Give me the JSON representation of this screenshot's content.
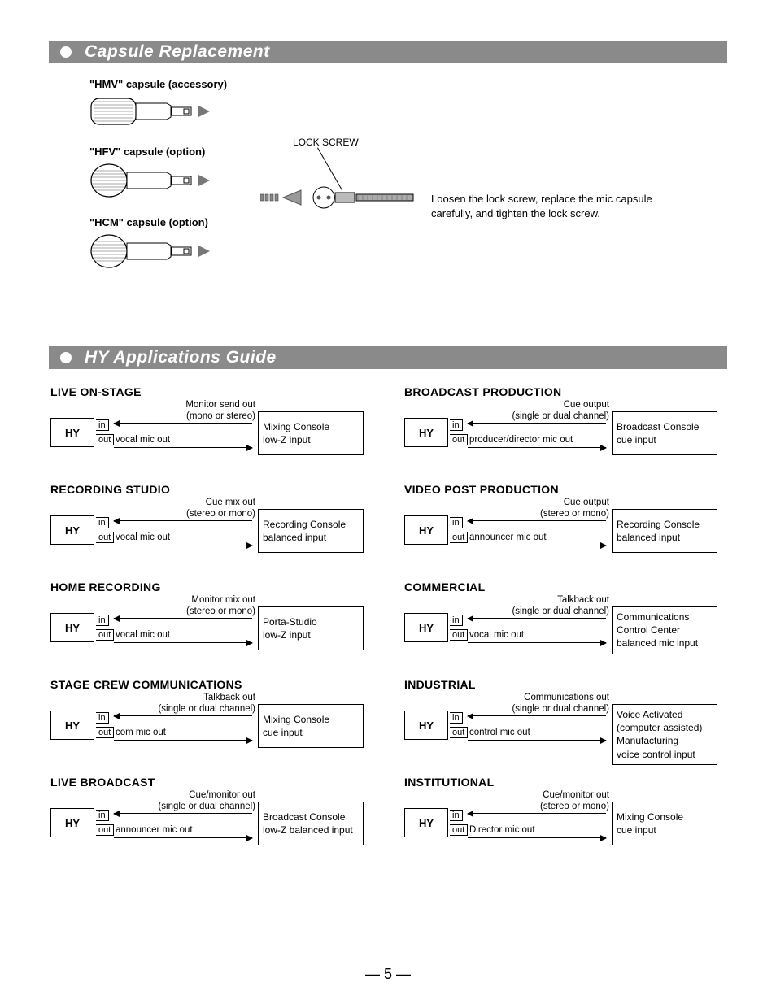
{
  "sections": {
    "capsule_title": "Capsule Replacement",
    "apps_title": "HY Applications Guide"
  },
  "capsule": {
    "hmv": "\"HMV\" capsule (accessory)",
    "hfv": "\"HFV\" capsule (option)",
    "hcm": "\"HCM\" capsule (option)",
    "lock": "LOCK SCREW",
    "instruction": "Loosen the lock screw, replace the mic capsule carefully, and tighten the lock screw."
  },
  "port": {
    "in": "in",
    "out": "out",
    "hy": "HY"
  },
  "apps_left": [
    {
      "title": "LIVE ON-STAGE",
      "line1": "Monitor send out",
      "line2": "(mono or stereo)",
      "out_text": "vocal mic out",
      "console1": "Mixing Console",
      "console2": "low-Z input"
    },
    {
      "title": "RECORDING STUDIO",
      "line1": "Cue mix out",
      "line2": "(stereo or mono)",
      "out_text": "vocal mic out",
      "console1": "Recording Console",
      "console2": "balanced input"
    },
    {
      "title": "HOME RECORDING",
      "line1": "Monitor mix out",
      "line2": "(stereo or mono)",
      "out_text": "vocal mic out",
      "console1": "Porta-Studio",
      "console2": "low-Z input"
    },
    {
      "title": "STAGE CREW COMMUNICATIONS",
      "line1": "Talkback out",
      "line2": "(single or dual channel)",
      "out_text": "com mic out",
      "console1": "Mixing Console",
      "console2": "cue input"
    },
    {
      "title": "LIVE BROADCAST",
      "line1": "Cue/monitor out",
      "line2": "(single or dual channel)",
      "out_text": "announcer mic out",
      "console1": "Broadcast Console",
      "console2": "low-Z balanced input"
    }
  ],
  "apps_right": [
    {
      "title": "BROADCAST PRODUCTION",
      "line1": "Cue output",
      "line2": "(single or dual channel)",
      "out_text": "producer/director mic out",
      "console1": "Broadcast Console",
      "console2": "cue input"
    },
    {
      "title": "VIDEO POST PRODUCTION",
      "line1": "Cue output",
      "line2": "(stereo or mono)",
      "out_text": "announcer mic out",
      "console1": "Recording Console",
      "console2": "balanced input"
    },
    {
      "title": "COMMERCIAL",
      "line1": "Talkback out",
      "line2": "(single or dual channel)",
      "out_text": "vocal mic out",
      "console1": "Communications Control Center",
      "console2": "balanced mic input"
    },
    {
      "title": "INDUSTRIAL",
      "line1": "Communications out",
      "line2": "(single or dual channel)",
      "out_text": "control mic out",
      "console1": "Voice Activated (computer assisted) Manufacturing",
      "console2": "voice control input"
    },
    {
      "title": "INSTITUTIONAL",
      "line1": "Cue/monitor out",
      "line2": "(stereo or mono)",
      "out_text": "Director mic out",
      "console1": "Mixing Console",
      "console2": "cue input"
    }
  ],
  "page": "— 5 —"
}
